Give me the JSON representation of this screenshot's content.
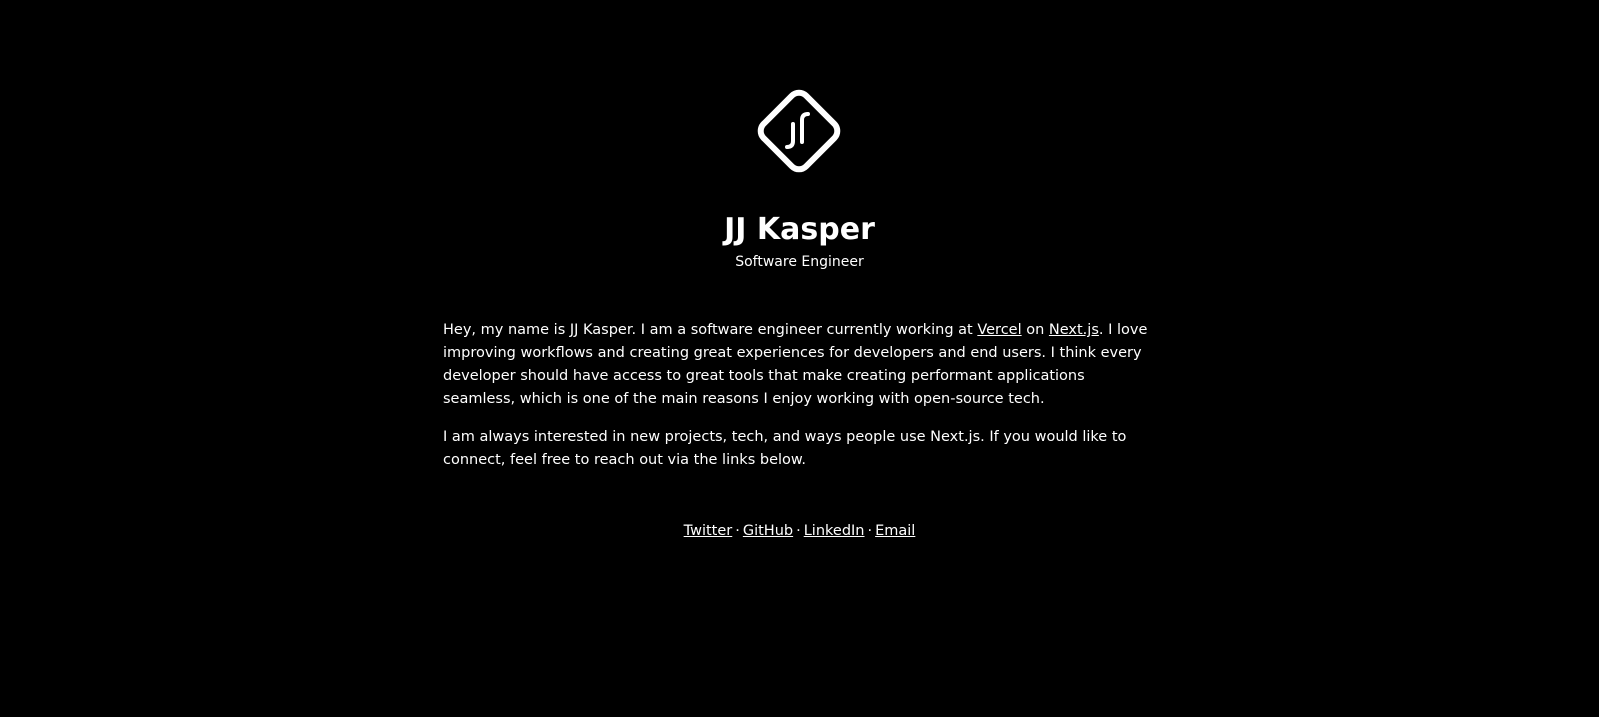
{
  "profile": {
    "logo_icon": "jj-diamond-logo-icon",
    "name": "JJ Kasper",
    "title": "Software Engineer"
  },
  "bio": {
    "p1_before_vercel": "Hey, my name is JJ Kasper. I am a software engineer currently working at ",
    "vercel_link": "Vercel",
    "p1_between": " on ",
    "nextjs_link": "Next.js",
    "p1_after": ". I love improving workflows and creating great experiences for developers and end users. I think every developer should have access to great tools that make creating performant applications seamless, which is one of the main reasons I enjoy working with open-source tech.",
    "p2": "I am always interested in new projects, tech, and ways people use Next.js. If you would like to connect, feel free to reach out via the links below."
  },
  "links": {
    "separator": "·",
    "twitter": "Twitter",
    "github": "GitHub",
    "linkedin": "LinkedIn",
    "email": "Email"
  },
  "colors": {
    "background": "#000000",
    "text": "#ffffff"
  }
}
